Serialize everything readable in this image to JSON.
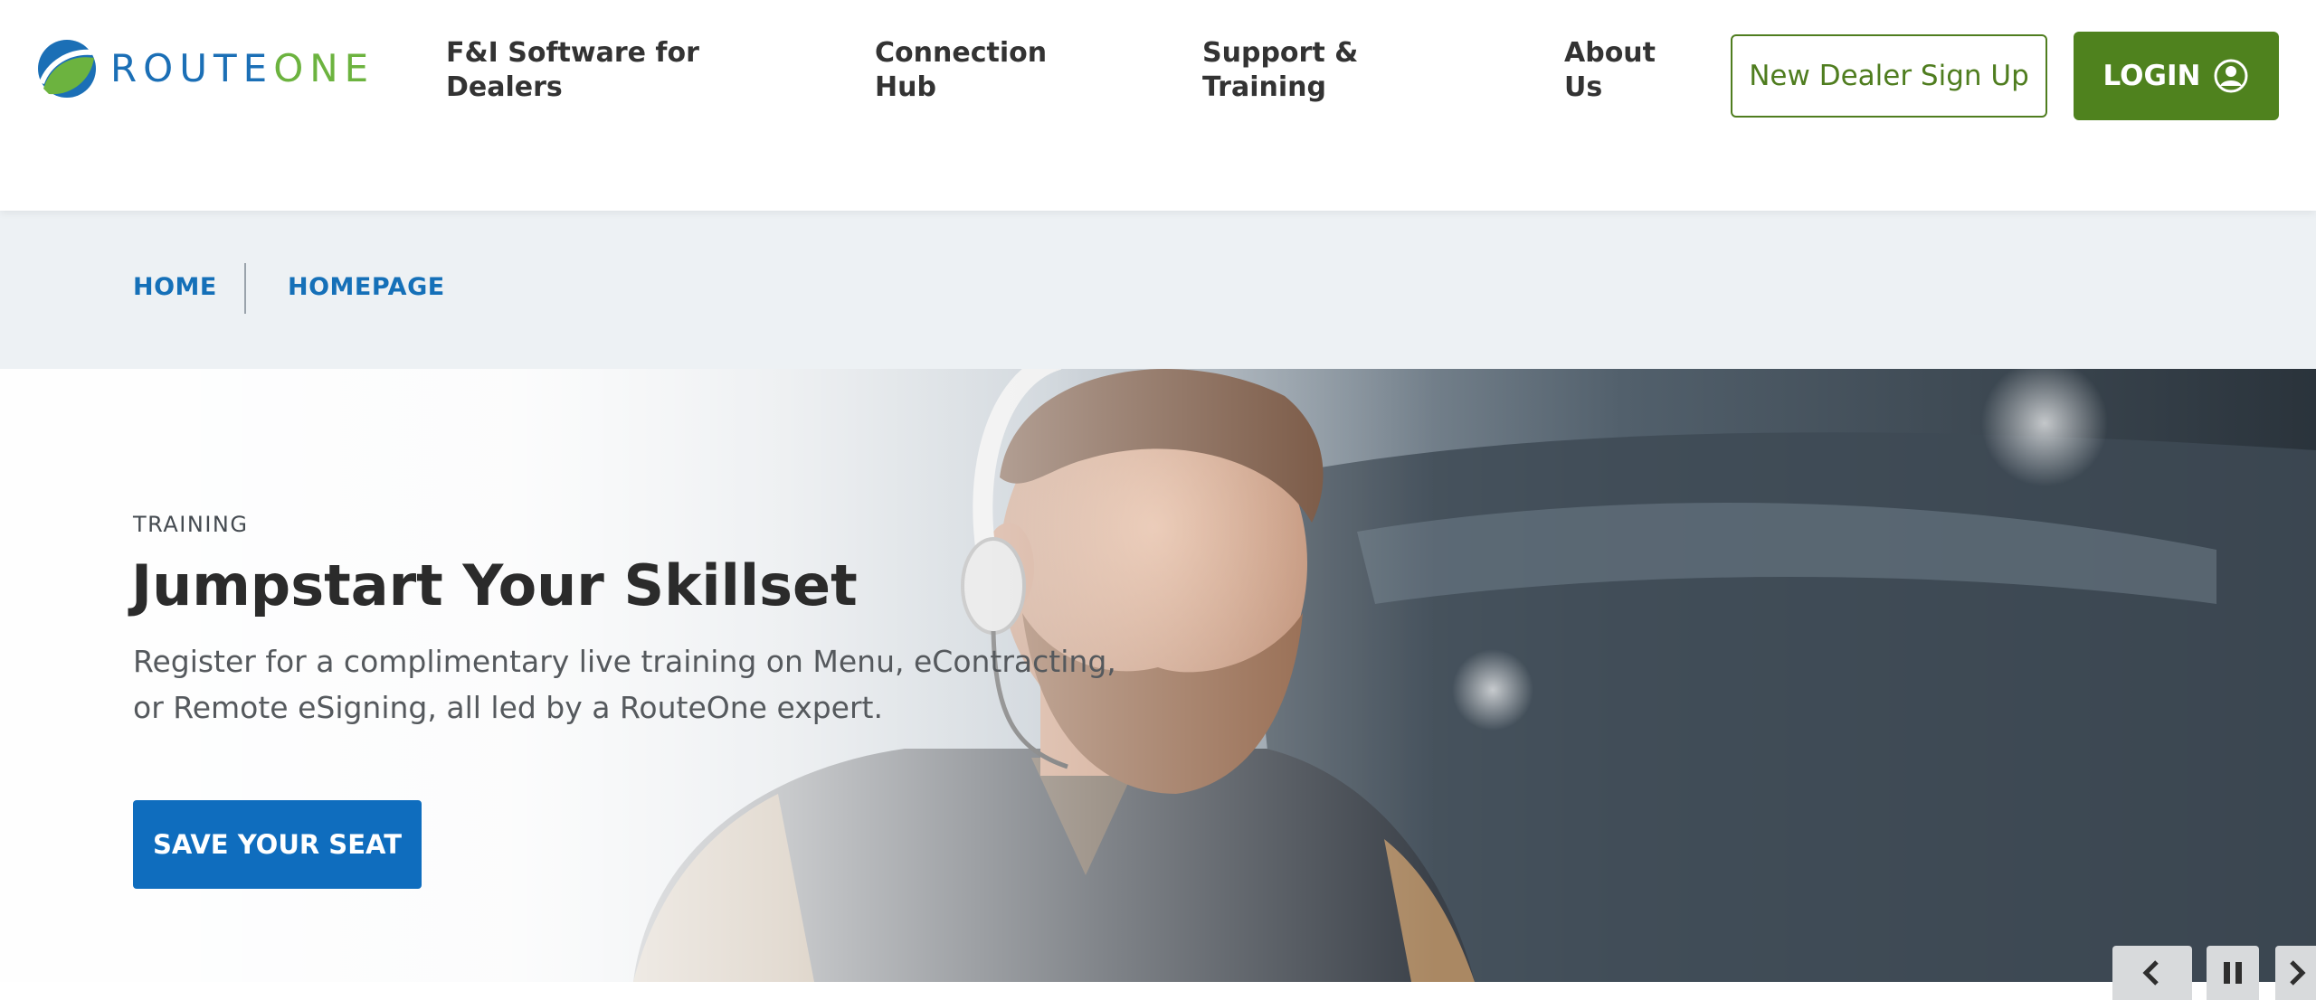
{
  "brand": {
    "logo_word_route": "ROUTE",
    "logo_word_one": "ONE",
    "colors": {
      "primary_blue": "#1570b8",
      "brand_green": "#4f821e",
      "logo_green": "#6cb33f"
    }
  },
  "nav": {
    "items": [
      {
        "line1": "F&I Software for",
        "line2": "Dealers"
      },
      {
        "line1": "Connection",
        "line2": "Hub"
      },
      {
        "line1": "Support &",
        "line2": "Training"
      },
      {
        "line1": "About",
        "line2": "Us"
      }
    ],
    "signup_label": "New Dealer Sign Up",
    "login_label": "LOGIN",
    "login_icon": "user-circle-icon"
  },
  "breadcrumb": {
    "items": [
      "HOME",
      "HOMEPAGE"
    ]
  },
  "hero": {
    "eyebrow": "TRAINING",
    "title": "Jumpstart Your Skillset",
    "body": "Register for a complimentary live training on Menu, eContracting, or Remote eSigning, all led by a RouteOne expert.",
    "cta_label": "SAVE YOUR SEAT",
    "image": "man-with-headset-smiling-photo"
  },
  "slider_controls": {
    "icons": [
      "chevron-left-icon",
      "pause-icon",
      "chevron-right-icon"
    ]
  }
}
